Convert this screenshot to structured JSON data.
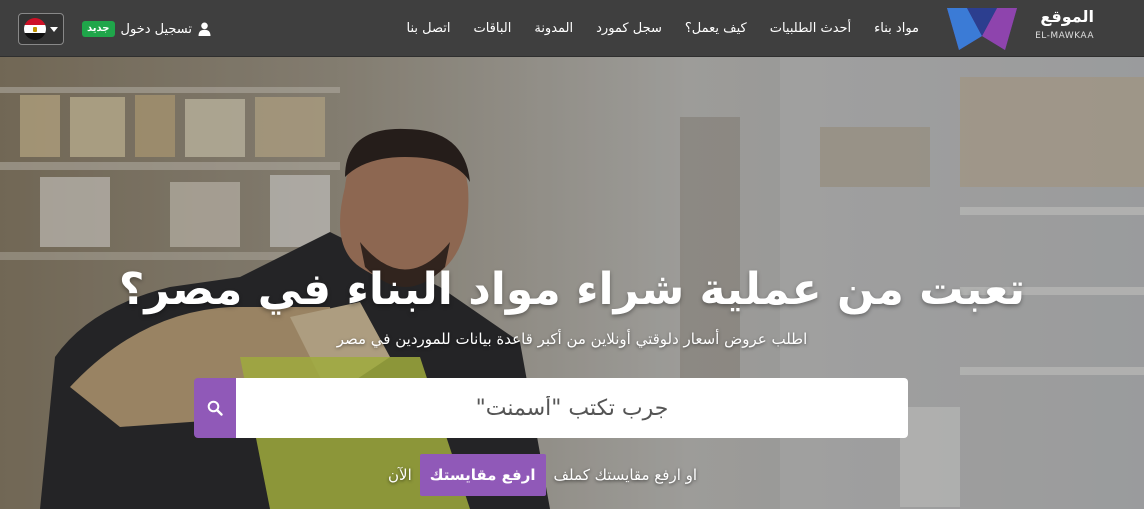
{
  "brand": {
    "name_ar": "الموقع",
    "name_en": "EL-MAWKAA",
    "logo_colors": [
      "#3b7bd6",
      "#8e44ad",
      "#2c3e8f"
    ]
  },
  "nav": {
    "items": [
      {
        "label": "مواد بناء"
      },
      {
        "label": "أحدث الطلبيات"
      },
      {
        "label": "كيف يعمل؟"
      },
      {
        "label": "سجل كمورد"
      },
      {
        "label": "المدونة"
      },
      {
        "label": "الباقات"
      },
      {
        "label": "اتصل بنا"
      }
    ],
    "login_label": "تسجيل دخول",
    "login_icon": "user-icon",
    "new_badge": "جديد",
    "language_flag": "egypt-flag-icon"
  },
  "hero": {
    "title": "تعبت من عملية شراء مواد البناء في مصر؟",
    "subtitle": "اطلب عروض أسعار دلوقتي أونلاين من أكبر قاعدة بيانات للموردين في مصر",
    "search_placeholder": "جرب تكتب \"أسمنت\"",
    "search_icon": "search-icon",
    "cta_prefix": "او ارفع مقايستك كملف",
    "cta_button": "ارفع مقايستك",
    "cta_suffix": "الآن"
  },
  "colors": {
    "navbar_bg": "#3f3f3f",
    "accent_purple": "#9059b8",
    "badge_green": "#1fa64a"
  }
}
